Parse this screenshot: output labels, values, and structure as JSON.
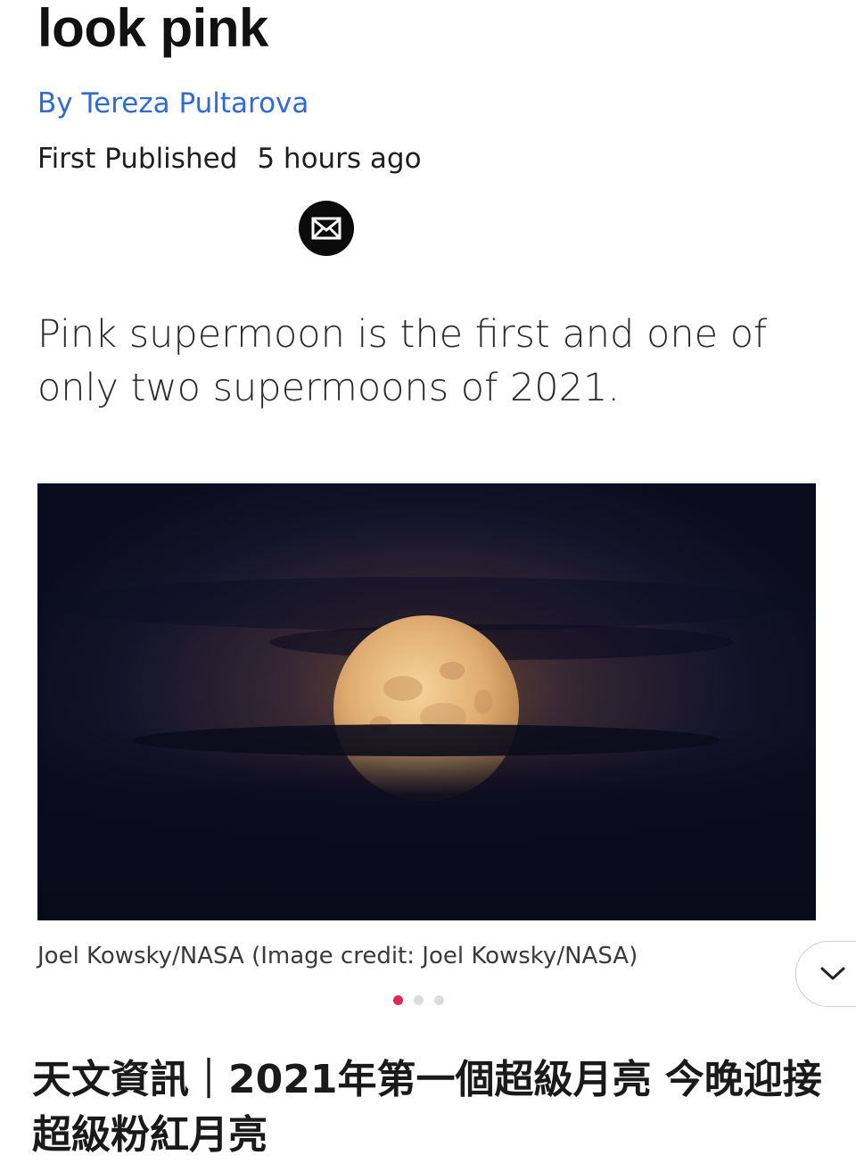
{
  "article": {
    "headline_tail": "look pink",
    "byline": "By Tereza Pultarova",
    "published_label": "First Published",
    "published_time": "5 hours ago",
    "subtitle": "Pink supermoon is the first and one of only two supermoons of 2021.",
    "image_caption": "Joel Kowsky/NASA (Image credit: Joel Kowsky/NASA)"
  },
  "share": {
    "icon": "envelope-icon"
  },
  "carousel": {
    "active_index": 0,
    "count": 3,
    "active_color": "#e5255a",
    "inactive_color": "#dcdcdc"
  },
  "expand": {
    "icon": "chevron-down-icon"
  },
  "next_title": "天文資訊｜2021年第一個超級月亮 今晚迎接超級粉紅月亮",
  "colors": {
    "byline": "#2f6bd2",
    "text": "#1a1a1a",
    "night_sky": "#0d0f22",
    "moon": "#e8b87c"
  }
}
